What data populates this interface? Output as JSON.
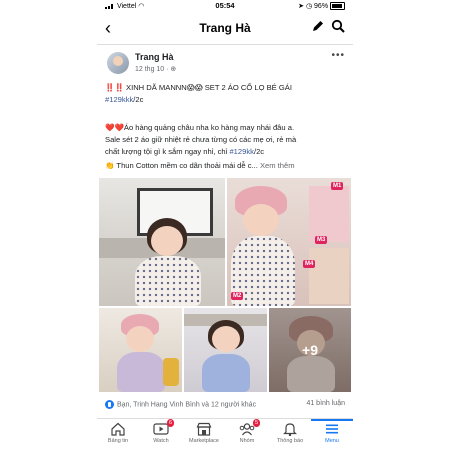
{
  "status_bar": {
    "carrier": "Viettel",
    "time": "05:54",
    "battery": "96%"
  },
  "header": {
    "back": "‹",
    "title": "Trang Hà"
  },
  "post": {
    "author": "Trang Hà",
    "date": "12 thg 10 ·",
    "line1_prefix": "‼️‼️ XINH DÃ MANNN😱😱 SET 2 ÁO CỔ LỌ BÉ GÁI",
    "line2_tag": "#129kkk",
    "line2_suffix": "/2c",
    "line4": "❤️❤️Áo hàng quảng châu nha ko hàng may nhái đâu a.",
    "line5": "Sale sét 2 áo giữ nhiệt rẻ chưa từng có các mẹ ơi, rẻ mà",
    "line6_prefix": "chất lượng tội gì k sắm ngay nhỉ, chỉ ",
    "line6_tag": "#129kk",
    "line6_suffix": "/2c",
    "line7": "👏 Thun Cotton mềm co dãn thoải mái dễ c...",
    "see_more": "Xem thêm",
    "photo_labels": {
      "m1": "M1",
      "m2": "M2",
      "m3": "M3",
      "m4": "M4"
    },
    "more_photos": "+9",
    "reactions_text": "Bạn, Trinh Hang Vinh Bình và 12 người khác",
    "comments_text": "41 bình luận"
  },
  "tabs": [
    {
      "label": "Bảng tin",
      "badge": ""
    },
    {
      "label": "Watch",
      "badge": "6"
    },
    {
      "label": "Marketplace",
      "badge": ""
    },
    {
      "label": "Nhóm",
      "badge": "5"
    },
    {
      "label": "Thông báo",
      "badge": ""
    },
    {
      "label": "Menu",
      "badge": ""
    }
  ],
  "colors": {
    "accent": "#1877f2",
    "hashtag": "#385898",
    "badge": "#e41e3f",
    "photo_label": "#e0245e"
  }
}
